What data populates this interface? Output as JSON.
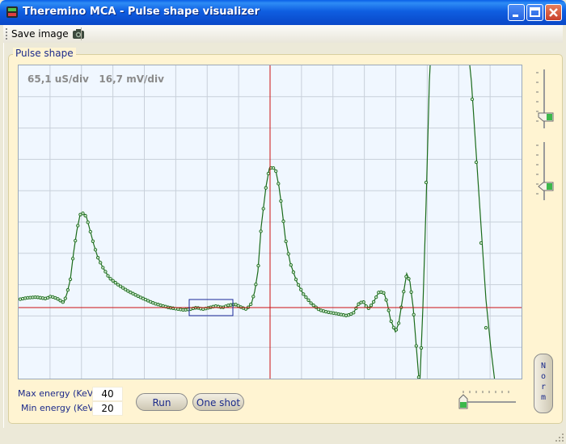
{
  "window": {
    "title": "Theremino MCA - Pulse shape visualizer"
  },
  "toolbar": {
    "save_label": "Save image",
    "save_icon": "camera-icon"
  },
  "group": {
    "label": "Pulse shape"
  },
  "plot": {
    "scale_text": "65,1 uS/div   16,7 mV/div",
    "background": "#f0f7ff",
    "grid_color": "#c8d0da",
    "cursor_color": "#cc1111",
    "trace_color": "#1a6b1a",
    "selection_color": "#1a2a9a"
  },
  "controls": {
    "max_energy_label": "Max energy (KeV)",
    "max_energy_value": "40",
    "min_energy_label": "Min energy (KeV)",
    "min_energy_value": "20",
    "run_label": "Run",
    "one_shot_label": "One shot",
    "norm_label": "N\no\nr\nm"
  },
  "colors": {
    "titlebar": "#0b4fd0",
    "panel": "#fff4d2",
    "label_text": "#1b2a8a"
  }
}
